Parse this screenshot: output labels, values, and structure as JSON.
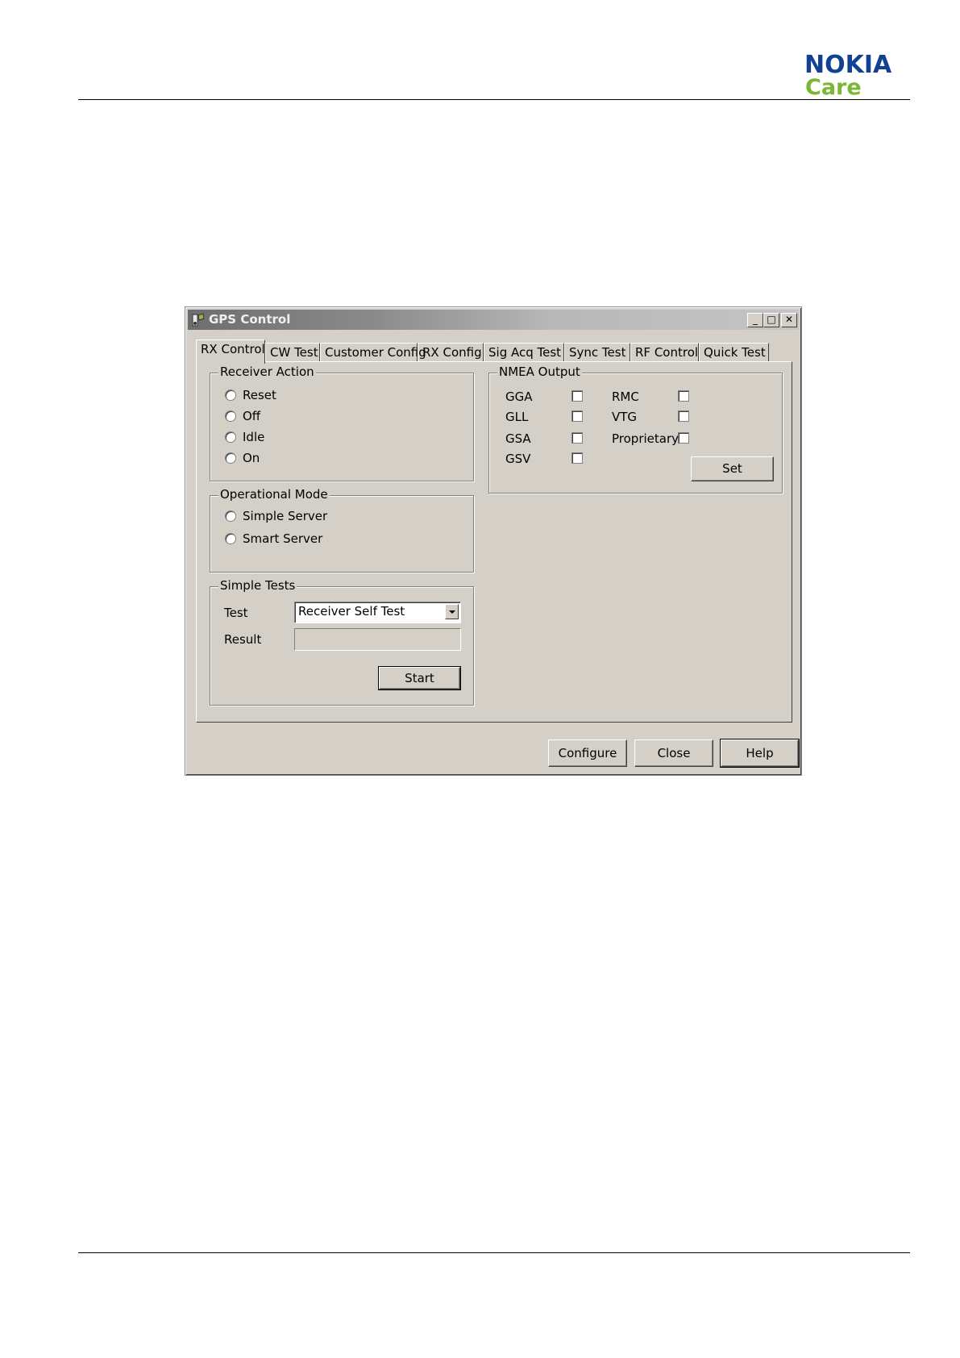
{
  "brand": {
    "name": "NOKIA",
    "sub": "Care",
    "name_color": "#124191",
    "sub_color": "#7ab733"
  },
  "window": {
    "title": "GPS Control",
    "icon": "gps-app-icon",
    "controls": {
      "minimize": "_",
      "maximize": "□",
      "close": "✕"
    },
    "tabs": [
      "RX Control",
      "CW Test",
      "Customer Config",
      "RX Config",
      "Sig Acq Test",
      "Sync Test",
      "RF Control",
      "Quick Test"
    ],
    "active_tab": "RX Control"
  },
  "receiver_action": {
    "legend": "Receiver Action",
    "options": [
      "Reset",
      "Off",
      "Idle",
      "On"
    ]
  },
  "operational_mode": {
    "legend": "Operational Mode",
    "options": [
      "Simple Server",
      "Smart Server"
    ]
  },
  "simple_tests": {
    "legend": "Simple Tests",
    "test_label": "Test",
    "test_value": "Receiver Self Test",
    "result_label": "Result",
    "result_value": "",
    "start_button": "Start"
  },
  "nmea_output": {
    "legend": "NMEA Output",
    "left": [
      "GGA",
      "GLL",
      "GSA",
      "GSV"
    ],
    "right": [
      "RMC",
      "VTG",
      "Proprietary"
    ],
    "set_button": "Set"
  },
  "footer_buttons": {
    "configure": "Configure",
    "close": "Close",
    "help": "Help"
  }
}
